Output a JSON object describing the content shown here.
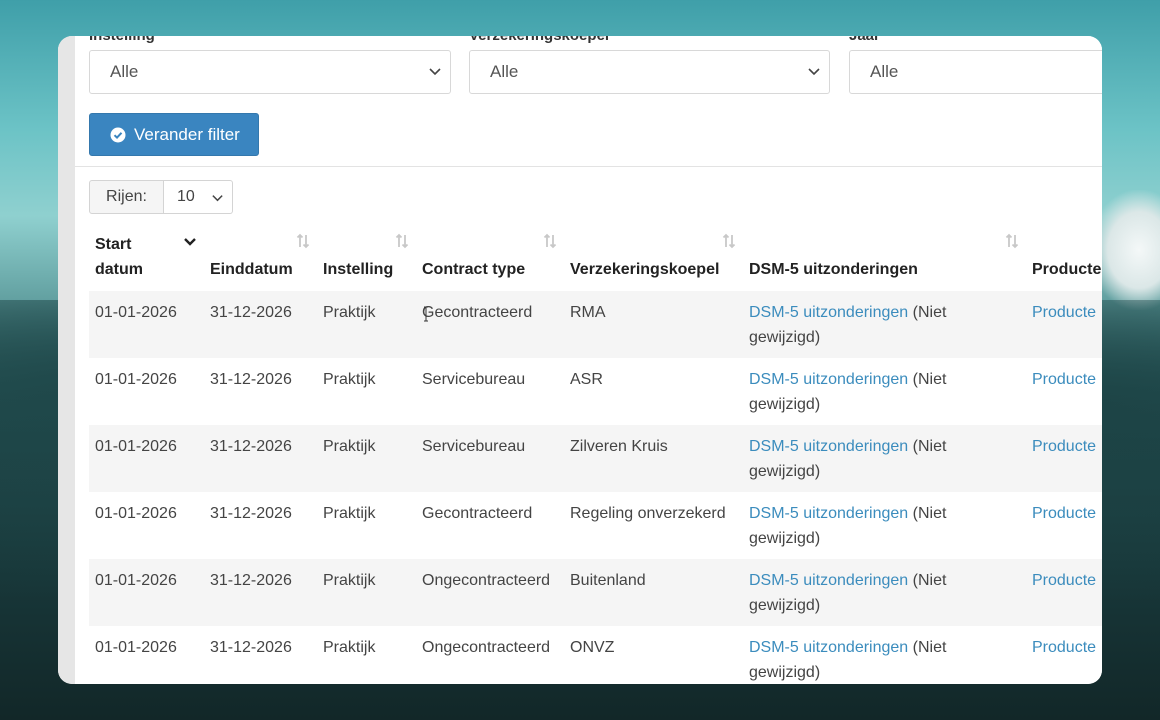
{
  "filters": {
    "instelling": {
      "label": "Instelling",
      "value": "Alle"
    },
    "verzekeringskoepel": {
      "label": "Verzekeringskoepel",
      "value": "Alle"
    },
    "jaar": {
      "label": "Jaar",
      "value": "Alle"
    }
  },
  "filter_button": {
    "label": "Verander filter",
    "icon": "check-circle-icon"
  },
  "rows": {
    "label": "Rijen:",
    "value": "10"
  },
  "table": {
    "headers": [
      {
        "label": "Start datum",
        "sort": "desc"
      },
      {
        "label": "Einddatum",
        "sort": "none"
      },
      {
        "label": "Instelling",
        "sort": "none"
      },
      {
        "label": "Contract type",
        "sort": "none"
      },
      {
        "label": "Verzekeringskoepel",
        "sort": "none"
      },
      {
        "label": "DSM-5 uitzonderingen",
        "sort": "none"
      },
      {
        "label": "Producte",
        "sort": "none"
      }
    ],
    "rows": [
      {
        "start": "01-01-2026",
        "end": "31-12-2026",
        "instelling": "Praktijk",
        "contract": "Gecontracteerd",
        "koepel": "RMA",
        "dsm_link": "DSM-5 uitzonderingen",
        "dsm_note": " (Niet gewijzigd)",
        "producten": "Producte"
      },
      {
        "start": "01-01-2026",
        "end": "31-12-2026",
        "instelling": "Praktijk",
        "contract": "Servicebureau",
        "koepel": "ASR",
        "dsm_link": "DSM-5 uitzonderingen",
        "dsm_note": " (Niet gewijzigd)",
        "producten": "Producte"
      },
      {
        "start": "01-01-2026",
        "end": "31-12-2026",
        "instelling": "Praktijk",
        "contract": "Servicebureau",
        "koepel": "Zilveren Kruis",
        "dsm_link": "DSM-5 uitzonderingen",
        "dsm_note": " (Niet gewijzigd)",
        "producten": "Producte"
      },
      {
        "start": "01-01-2026",
        "end": "31-12-2026",
        "instelling": "Praktijk",
        "contract": "Gecontracteerd",
        "koepel": "Regeling onverzekerd",
        "dsm_link": "DSM-5 uitzonderingen",
        "dsm_note": " (Niet gewijzigd)",
        "producten": "Producte"
      },
      {
        "start": "01-01-2026",
        "end": "31-12-2026",
        "instelling": "Praktijk",
        "contract": "Ongecontracteerd",
        "koepel": "Buitenland",
        "dsm_link": "DSM-5 uitzonderingen",
        "dsm_note": " (Niet gewijzigd)",
        "producten": "Producte"
      },
      {
        "start": "01-01-2026",
        "end": "31-12-2026",
        "instelling": "Praktijk",
        "contract": "Ongecontracteerd",
        "koepel": "ONVZ",
        "dsm_link": "DSM-5 uitzonderingen",
        "dsm_note": " (Niet gewijzigd)",
        "producten": "Producte"
      }
    ]
  },
  "colors": {
    "accent": "#3a85c0",
    "link": "#3b8cbd",
    "stripe": "#f5f5f5"
  }
}
